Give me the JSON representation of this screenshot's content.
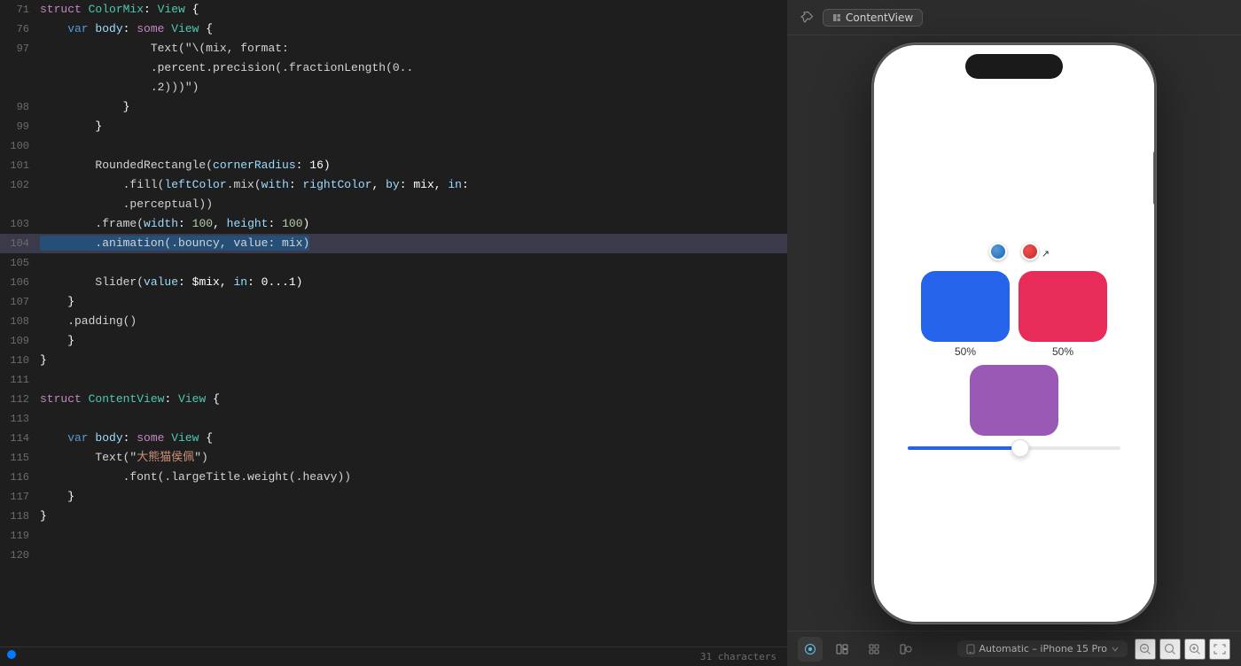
{
  "editor": {
    "lines": [
      {
        "num": "71",
        "tokens": [
          {
            "text": "struct ",
            "cls": "kw-purple"
          },
          {
            "text": "ColorMix",
            "cls": "kw-struct"
          },
          {
            "text": ": ",
            "cls": "white"
          },
          {
            "text": "View",
            "cls": "kw-struct"
          },
          {
            "text": " {",
            "cls": "white"
          }
        ],
        "highlighted": false
      },
      {
        "num": "76",
        "tokens": [
          {
            "text": "    var ",
            "cls": "kw-blue"
          },
          {
            "text": "body",
            "cls": "param-teal"
          },
          {
            "text": ": ",
            "cls": "white"
          },
          {
            "text": "some ",
            "cls": "kw-some"
          },
          {
            "text": "View",
            "cls": "kw-struct"
          },
          {
            "text": " {",
            "cls": "white"
          }
        ],
        "highlighted": false
      },
      {
        "num": "97",
        "tokens": [
          {
            "text": "                Text(\"\\(mix, format:\n                .percent.precision(.fractionLength(0..\n                .2)))\")",
            "cls": "method-light"
          }
        ],
        "highlighted": false,
        "multiline": true
      },
      {
        "num": "98",
        "tokens": [
          {
            "text": "            }",
            "cls": "white"
          }
        ],
        "highlighted": false
      },
      {
        "num": "99",
        "tokens": [
          {
            "text": "        }",
            "cls": "white"
          }
        ],
        "highlighted": false
      },
      {
        "num": "100",
        "tokens": [],
        "highlighted": false
      },
      {
        "num": "101",
        "tokens": [
          {
            "text": "        RoundedRectangle(",
            "cls": "fn-yellow"
          },
          {
            "text": "cornerRadius",
            "cls": "param-teal"
          },
          {
            "text": ": 16)",
            "cls": "white"
          }
        ],
        "highlighted": false
      },
      {
        "num": "102",
        "tokens": [
          {
            "text": "            .fill(",
            "cls": "method-light"
          },
          {
            "text": "leftColor",
            "cls": "param-teal"
          },
          {
            "text": ".mix(",
            "cls": "method-light"
          },
          {
            "text": "with",
            "cls": "param-teal"
          },
          {
            "text": ": ",
            "cls": "white"
          },
          {
            "text": "rightColor",
            "cls": "param-teal"
          },
          {
            "text": ", ",
            "cls": "white"
          },
          {
            "text": "by",
            "cls": "param-teal"
          },
          {
            "text": ": mix, ",
            "cls": "white"
          },
          {
            "text": "in",
            "cls": "param-teal"
          },
          {
            "text": ":",
            "cls": "white"
          }
        ],
        "highlighted": false
      },
      {
        "num": "",
        "tokens": [
          {
            "text": "            .perceptual))",
            "cls": "method-light"
          }
        ],
        "highlighted": false
      },
      {
        "num": "103",
        "tokens": [
          {
            "text": "        .frame(",
            "cls": "method-light"
          },
          {
            "text": "width",
            "cls": "param-teal"
          },
          {
            "text": ": ",
            "cls": "white"
          },
          {
            "text": "100",
            "cls": "num-green"
          },
          {
            "text": ", ",
            "cls": "white"
          },
          {
            "text": "height",
            "cls": "param-teal"
          },
          {
            "text": ": ",
            "cls": "white"
          },
          {
            "text": "100",
            "cls": "num-green"
          },
          {
            "text": ")",
            "cls": "white"
          }
        ],
        "highlighted": false
      },
      {
        "num": "104",
        "tokens": [
          {
            "text": "        .animation(",
            "cls": "selected"
          },
          {
            "text": ".bouncy",
            "cls": "selected"
          },
          {
            "text": ", ",
            "cls": "selected"
          },
          {
            "text": "value",
            "cls": "selected"
          },
          {
            "text": ": ",
            "cls": "selected"
          },
          {
            "text": "mix",
            "cls": "selected"
          },
          {
            "text": ")",
            "cls": "selected"
          }
        ],
        "highlighted": true
      },
      {
        "num": "105",
        "tokens": [],
        "highlighted": false
      },
      {
        "num": "106",
        "tokens": [
          {
            "text": "        Slider(",
            "cls": "fn-yellow"
          },
          {
            "text": "value",
            "cls": "param-teal"
          },
          {
            "text": ": $mix, ",
            "cls": "white"
          },
          {
            "text": "in",
            "cls": "param-teal"
          },
          {
            "text": ": 0...1)",
            "cls": "white"
          }
        ],
        "highlighted": false
      },
      {
        "num": "107",
        "tokens": [
          {
            "text": "    }",
            "cls": "white"
          }
        ],
        "highlighted": false
      },
      {
        "num": "108",
        "tokens": [
          {
            "text": "    .padding()",
            "cls": "method-light"
          }
        ],
        "highlighted": false
      },
      {
        "num": "109",
        "tokens": [
          {
            "text": "}",
            "cls": "white"
          }
        ],
        "highlighted": false
      },
      {
        "num": "110",
        "tokens": [
          {
            "text": "}",
            "cls": "white"
          }
        ],
        "highlighted": false
      },
      {
        "num": "111",
        "tokens": [],
        "highlighted": false
      },
      {
        "num": "112",
        "tokens": [
          {
            "text": "struct ",
            "cls": "kw-purple"
          },
          {
            "text": "ContentView",
            "cls": "kw-struct"
          },
          {
            "text": ": ",
            "cls": "white"
          },
          {
            "text": "View",
            "cls": "kw-struct"
          },
          {
            "text": " {",
            "cls": "white"
          }
        ],
        "highlighted": false
      },
      {
        "num": "113",
        "tokens": [],
        "highlighted": false
      },
      {
        "num": "114",
        "tokens": [
          {
            "text": "    var ",
            "cls": "kw-blue"
          },
          {
            "text": "body",
            "cls": "param-teal"
          },
          {
            "text": ": ",
            "cls": "white"
          },
          {
            "text": "some ",
            "cls": "kw-some"
          },
          {
            "text": "View",
            "cls": "kw-struct"
          },
          {
            "text": " {",
            "cls": "white"
          }
        ],
        "highlighted": false
      },
      {
        "num": "115",
        "tokens": [
          {
            "text": "        Text(\"",
            "cls": "method-light"
          },
          {
            "text": "大熊猫侯佩",
            "cls": "str-orange"
          },
          {
            "text": "\")",
            "cls": "method-light"
          }
        ],
        "highlighted": false
      },
      {
        "num": "116",
        "tokens": [
          {
            "text": "            .font(.largeTitle.weight(.heavy))",
            "cls": "method-light"
          }
        ],
        "highlighted": false
      },
      {
        "num": "117",
        "tokens": [
          {
            "text": "    }",
            "cls": "white"
          }
        ],
        "highlighted": false
      },
      {
        "num": "118",
        "tokens": [
          {
            "text": "}",
            "cls": "white"
          }
        ],
        "highlighted": false
      },
      {
        "num": "119",
        "tokens": [],
        "highlighted": false
      },
      {
        "num": "120",
        "tokens": [],
        "highlighted": false
      }
    ]
  },
  "preview": {
    "header": {
      "content_view_label": "ContentView"
    },
    "app": {
      "blue_pct": "50%",
      "red_pct": "50%",
      "slider_value": 50
    },
    "toolbar": {
      "device_label": "Automatic – iPhone 15 Pro",
      "characters_label": "31 characters"
    }
  }
}
